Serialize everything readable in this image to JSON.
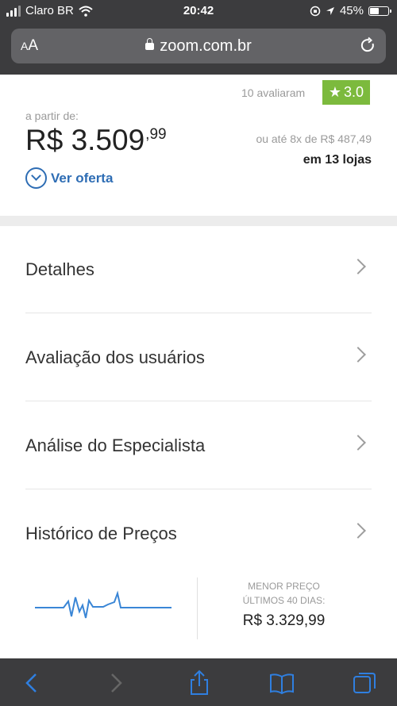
{
  "status": {
    "carrier": "Claro BR",
    "time": "20:42",
    "battery": "45%"
  },
  "browser": {
    "aa_label_small": "A",
    "aa_label_big": "A",
    "url": "zoom.com.br"
  },
  "product": {
    "rating_count": "10 avaliaram",
    "rating_value": "3.0",
    "from_label": "a partir de:",
    "price_main": "R$ 3.509",
    "price_cents": ",99",
    "installments": "ou até 8x de R$ 487,49",
    "stores": "em 13 lojas",
    "offer_label": "Ver oferta"
  },
  "sections": [
    {
      "label": "Detalhes"
    },
    {
      "label": "Avaliação dos usuários"
    },
    {
      "label": "Análise do Especialista"
    },
    {
      "label": "Histórico de Preços"
    }
  ],
  "history": {
    "title_line1": "MENOR PREÇO",
    "title_line2": "ÚLTIMOS 40 DIAS:",
    "value": "R$ 3.329,99"
  },
  "colors": {
    "rating_green": "#7cba3d",
    "link_blue": "#2e6db4",
    "chrome_dark": "#3c3c3e"
  },
  "icons": [
    "wifi-icon",
    "lock-icon",
    "reload-icon",
    "star-icon",
    "back-icon",
    "forward-icon",
    "share-icon",
    "bookmarks-icon",
    "tabs-icon"
  ]
}
